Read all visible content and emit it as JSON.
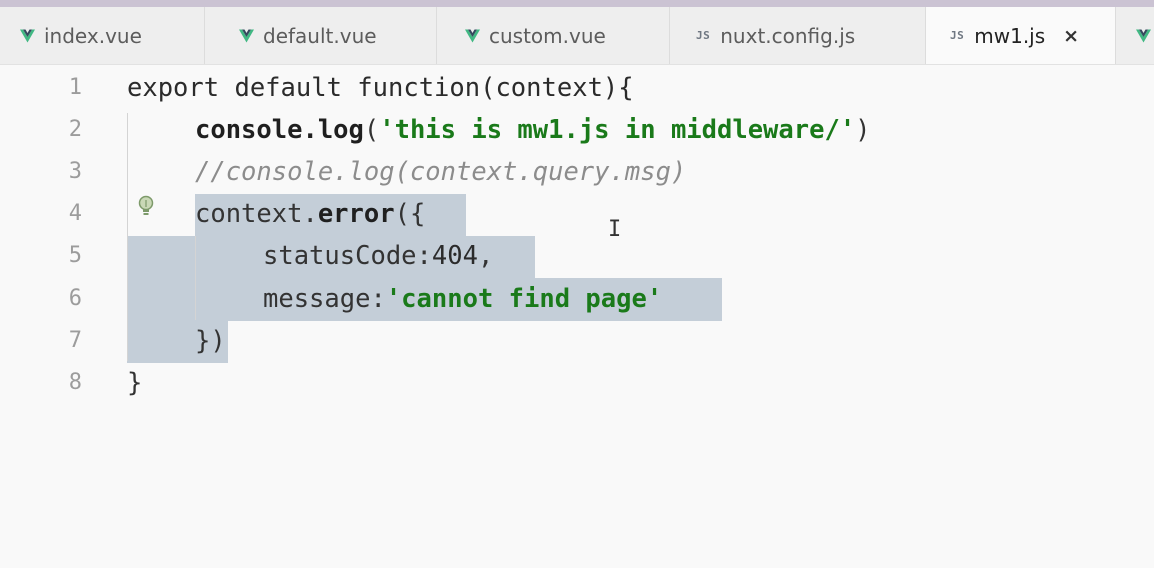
{
  "tabs": [
    {
      "label": "index.vue",
      "icon": "vue-icon",
      "active": false
    },
    {
      "label": "default.vue",
      "icon": "vue-icon",
      "active": false
    },
    {
      "label": "custom.vue",
      "icon": "vue-icon",
      "active": false
    },
    {
      "label": "nuxt.config.js",
      "icon": "js-icon",
      "icon_text": "JS",
      "active": false
    },
    {
      "label": "mw1.js",
      "icon": "js-icon",
      "icon_text": "JS",
      "active": true,
      "close": "×"
    }
  ],
  "colors": {
    "vue_green": "#41b883",
    "vue_dark": "#35495e",
    "selection": "#c4ced8",
    "string_green": "#1a7a1a",
    "comment_gray": "#8c8c8c"
  },
  "editor": {
    "line_numbers": [
      "1",
      "2",
      "3",
      "4",
      "5",
      "6",
      "7",
      "8"
    ],
    "lines": {
      "l1": "export default function(context){",
      "l2_obj": "console.",
      "l2_fn": "log",
      "l2_open": "(",
      "l2_str": "'this is mw1.js in middleware/'",
      "l2_close": ")",
      "l3": "//console.log(context.query.msg)",
      "l4_obj": "context.",
      "l4_fn": "error",
      "l4_rest": "({",
      "l5_key": "statusCode:",
      "l5_num": "404",
      "l5_comma": ",",
      "l6_key": "message:",
      "l6_str": "'cannot find page'",
      "l7": "})",
      "l8": "}"
    }
  }
}
